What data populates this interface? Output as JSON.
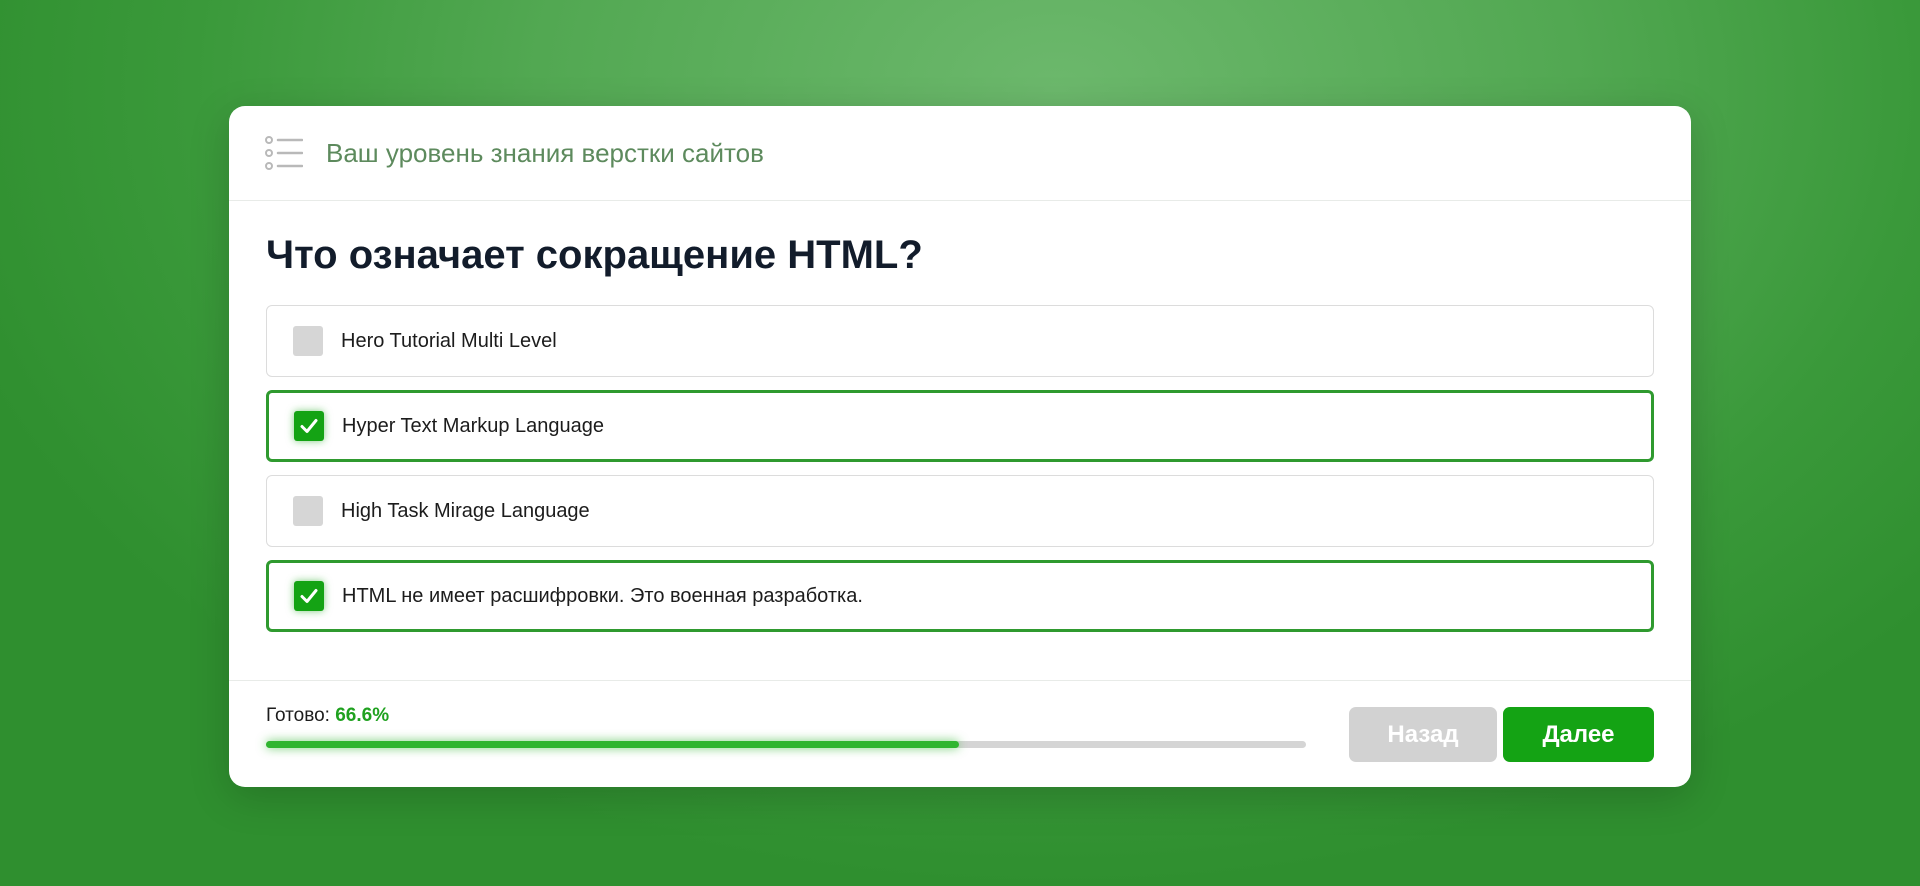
{
  "quiz": {
    "title": "Ваш уровень знания верстки сайтов",
    "title_icon": "list-icon",
    "question": "Что означает сокращение HTML?",
    "options": [
      {
        "label": "Hero Tutorial Multi Level",
        "checked": false
      },
      {
        "label": "Hyper Text Markup Language",
        "checked": true
      },
      {
        "label": "High Task Mirage Language",
        "checked": false
      },
      {
        "label": "HTML не имеет расшифровки. Это военная разработка.",
        "checked": true
      }
    ],
    "progress": {
      "label": "Готово:",
      "value_text": "66.6%",
      "fraction": 0.666
    },
    "buttons": {
      "back": "Назад",
      "next": "Далее"
    }
  },
  "colors": {
    "accent": "#14a314",
    "title_text": "#5d8a5d",
    "disabled": "#d2d2d2"
  }
}
